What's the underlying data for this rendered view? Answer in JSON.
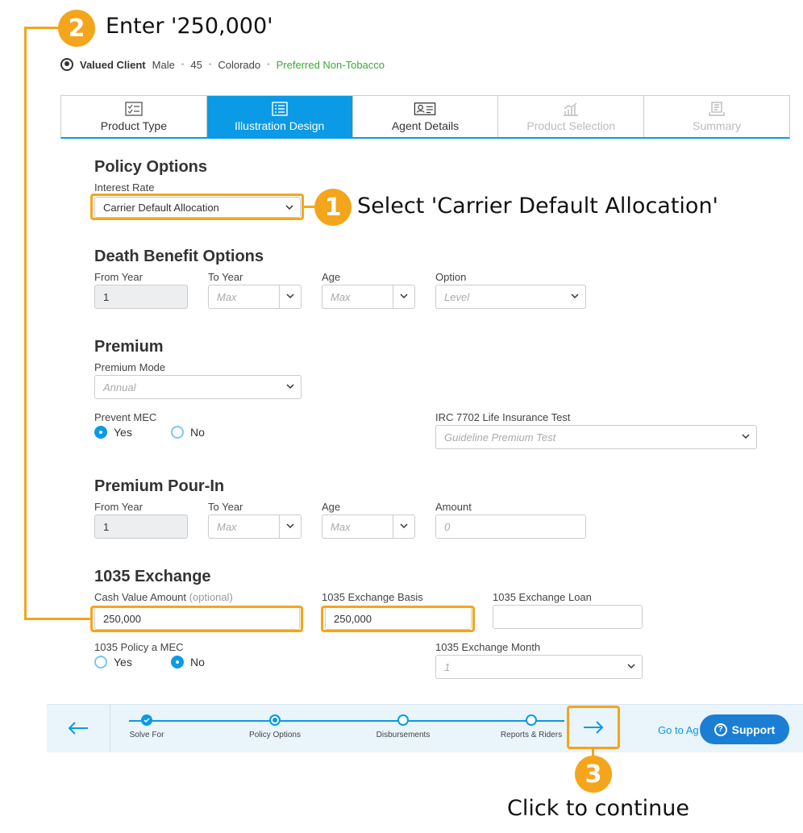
{
  "callouts": {
    "step1_number": "1",
    "step1_text": "Select 'Carrier Default Allocation'",
    "step2_number": "2",
    "step2_text": "Enter '250,000'",
    "step3_number": "3",
    "step3_text": "Click to continue",
    "color": "#f4a51c"
  },
  "client": {
    "name": "Valued Client",
    "gender": "Male",
    "age": "45",
    "state": "Colorado",
    "rate_class": "Preferred Non-Tobacco"
  },
  "tabs": [
    {
      "label": "Product Type",
      "icon": "checklist-icon",
      "state": "normal"
    },
    {
      "label": "Illustration Design",
      "icon": "form-icon",
      "state": "active"
    },
    {
      "label": "Agent Details",
      "icon": "id-card-icon",
      "state": "normal"
    },
    {
      "label": "Product Selection",
      "icon": "chart-icon",
      "state": "disabled"
    },
    {
      "label": "Summary",
      "icon": "document-icon",
      "state": "disabled"
    }
  ],
  "policy_options": {
    "title": "Policy Options",
    "interest_rate_label": "Interest Rate",
    "interest_rate_value": "Carrier Default Allocation"
  },
  "death_benefit": {
    "title": "Death Benefit Options",
    "from_year_label": "From Year",
    "from_year_value": "1",
    "to_year_label": "To Year",
    "to_year_placeholder": "Max",
    "age_label": "Age",
    "age_placeholder": "Max",
    "option_label": "Option",
    "option_placeholder": "Level"
  },
  "premium": {
    "title": "Premium",
    "mode_label": "Premium Mode",
    "mode_placeholder": "Annual",
    "prevent_mec_label": "Prevent MEC",
    "yes": "Yes",
    "no": "No",
    "prevent_mec_selected": "Yes",
    "irc_label": "IRC 7702 Life Insurance Test",
    "irc_placeholder": "Guideline Premium Test"
  },
  "pour_in": {
    "title": "Premium Pour-In",
    "from_year_label": "From Year",
    "from_year_value": "1",
    "to_year_label": "To Year",
    "to_year_placeholder": "Max",
    "age_label": "Age",
    "age_placeholder": "Max",
    "amount_label": "Amount",
    "amount_placeholder": "0"
  },
  "exchange": {
    "title": "1035 Exchange",
    "cash_value_label": "Cash Value Amount",
    "cash_value_optional": "(optional)",
    "cash_value_value": "250,000",
    "basis_label": "1035 Exchange Basis",
    "basis_value": "250,000",
    "loan_label": "1035 Exchange Loan",
    "loan_value": "",
    "mec_label": "1035 Policy a MEC",
    "yes": "Yes",
    "no": "No",
    "mec_selected": "No",
    "month_label": "1035 Exchange Month",
    "month_placeholder": "1"
  },
  "bottom_nav": {
    "steps": [
      {
        "label": "Solve For",
        "state": "done"
      },
      {
        "label": "Policy Options",
        "state": "current"
      },
      {
        "label": "Disbursements",
        "state": "todo"
      },
      {
        "label": "Reports & Riders",
        "state": "todo"
      }
    ],
    "go_link": "Go to Ag",
    "support_label": "Support"
  }
}
